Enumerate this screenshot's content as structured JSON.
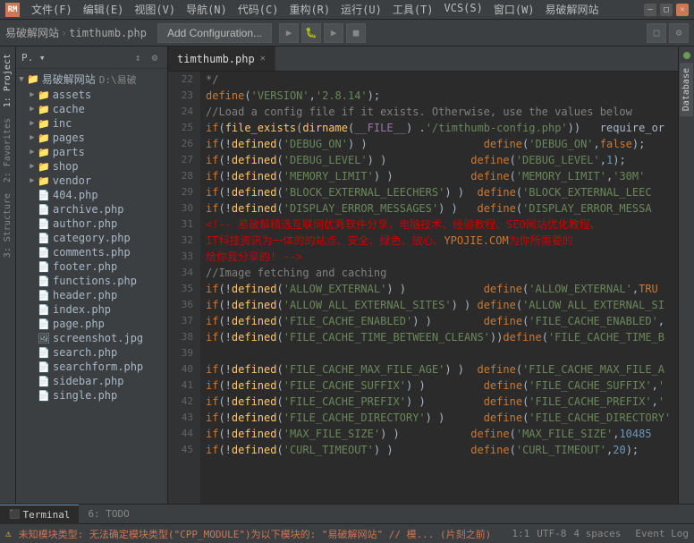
{
  "titlebar": {
    "app_icon": "RM",
    "menus": [
      "文件(F)",
      "编辑(E)",
      "视图(V)",
      "导航(N)",
      "代码(C)",
      "重构(R)",
      "运行(U)",
      "工具(T)",
      "VCS(S)",
      "窗口(W)",
      "易破解网站"
    ],
    "title": "易破解网站",
    "win_controls": [
      "—",
      "□",
      "✕"
    ]
  },
  "toolbar": {
    "breadcrumb": [
      "易破解网站",
      "timthumb.php"
    ],
    "config_btn": "Add Configuration...",
    "layout_icons": [
      "□"
    ]
  },
  "sidebar": {
    "header": "P. ▾",
    "icons": [
      "↕",
      "⚙"
    ],
    "root_label": "易破解网站",
    "root_path": "D:\\易破",
    "items": [
      {
        "type": "folder",
        "label": "assets",
        "indent": 1,
        "expanded": false
      },
      {
        "type": "folder",
        "label": "cache",
        "indent": 1,
        "expanded": false
      },
      {
        "type": "folder",
        "label": "inc",
        "indent": 1,
        "expanded": false
      },
      {
        "type": "folder",
        "label": "pages",
        "indent": 1,
        "expanded": false
      },
      {
        "type": "folder",
        "label": "parts",
        "indent": 1,
        "expanded": false
      },
      {
        "type": "folder",
        "label": "shop",
        "indent": 1,
        "expanded": false
      },
      {
        "type": "folder",
        "label": "vendor",
        "indent": 1,
        "expanded": false
      },
      {
        "type": "file",
        "label": "404.php",
        "indent": 1
      },
      {
        "type": "file",
        "label": "archive.php",
        "indent": 1
      },
      {
        "type": "file",
        "label": "author.php",
        "indent": 1
      },
      {
        "type": "file",
        "label": "category.php",
        "indent": 1
      },
      {
        "type": "file",
        "label": "comments.php",
        "indent": 1
      },
      {
        "type": "file",
        "label": "footer.php",
        "indent": 1
      },
      {
        "type": "file",
        "label": "functions.php",
        "indent": 1
      },
      {
        "type": "file",
        "label": "header.php",
        "indent": 1
      },
      {
        "type": "file",
        "label": "index.php",
        "indent": 1
      },
      {
        "type": "file",
        "label": "page.php",
        "indent": 1
      },
      {
        "type": "file",
        "label": "screenshot.jpg",
        "indent": 1
      },
      {
        "type": "file",
        "label": "search.php",
        "indent": 1
      },
      {
        "type": "file",
        "label": "searchform.php",
        "indent": 1
      },
      {
        "type": "file",
        "label": "sidebar.php",
        "indent": 1
      },
      {
        "type": "file",
        "label": "single.php",
        "indent": 1
      }
    ]
  },
  "editor": {
    "tab_label": "timthumb.php",
    "lines": [
      {
        "num": 22,
        "content": "*/"
      },
      {
        "num": 23,
        "content": "define ('VERSION', '2.8.14');"
      },
      {
        "num": 24,
        "content": "//Load a config file if it exists. Otherwise, use the values below"
      },
      {
        "num": 25,
        "content": "if( file_exists(dirname(__FILE__) . '/timthumb-config.php'))   require_or"
      },
      {
        "num": 26,
        "content": "if(! defined('DEBUG_ON') )                  define ('DEBUG_ON', false);"
      },
      {
        "num": 27,
        "content": "if(! defined('DEBUG_LEVEL') )               define ('DEBUG_LEVEL', 1);"
      },
      {
        "num": 28,
        "content": "if(! defined('MEMORY_LIMIT') )              define ('MEMORY_LIMIT', '30M'"
      },
      {
        "num": 29,
        "content": "if(! defined('BLOCK_EXTERNAL_LEECHERS') )   define ('BLOCK_EXTERNAL_LEEC"
      },
      {
        "num": 30,
        "content": "if(! defined('DISPLAY_ERROR_MESSAGES') )    define ('DISPLAY_ERROR_MESSA"
      },
      {
        "num": 31,
        "content": "<!-- 易破解精选互联网优秀软件分享，电脑技术、经验教程、SEO网站优化教程、"
      },
      {
        "num": 32,
        "content": "IT科技资讯为一体的的站点、安全、绿色、放心、YPOJIE.COM为你所需要的"
      },
      {
        "num": 33,
        "content": "给你我分享的! -->"
      },
      {
        "num": 34,
        "content": "//Image fetching and caching"
      },
      {
        "num": 35,
        "content": "if(! defined('ALLOW_EXTERNAL') )            define ('ALLOW_EXTERNAL', TRU"
      },
      {
        "num": 36,
        "content": "if(! defined('ALLOW_ALL_EXTERNAL_SITES') )  define ('ALLOW_ALL_EXTERNAL_SI"
      },
      {
        "num": 37,
        "content": "if(! defined('FILE_CACHE_ENABLED') )        define ('FILE_CACHE_ENABLED',"
      },
      {
        "num": 38,
        "content": "if(! defined('FILE_CACHE_TIME_BETWEEN_CLEANS')) define ('FILE_CACHE_TIME_B"
      },
      {
        "num": 39,
        "content": ""
      },
      {
        "num": 40,
        "content": "if(! defined('FILE_CACHE_MAX_FILE_AGE') )   define ('FILE_CACHE_MAX_FILE_A"
      },
      {
        "num": 41,
        "content": "if(! defined('FILE_CACHE_SUFFIX') )         define ('FILE_CACHE_SUFFIX', '"
      },
      {
        "num": 42,
        "content": "if(! defined('FILE_CACHE_PREFIX') )         define ('FILE_CACHE_PREFIX', '"
      },
      {
        "num": 43,
        "content": "if(! defined('FILE_CACHE_DIRECTORY') )      define ('FILE_CACHE_DIRECTORY'"
      },
      {
        "num": 44,
        "content": "if(! defined('MAX_FILE_SIZE') )             define ('MAX_FILE_SIZE', 10485"
      },
      {
        "num": 45,
        "content": "if(! defined('CURL_TIMEOUT') )              define ('CURL_TIMEOUT', 20);"
      }
    ]
  },
  "left_panel_tabs": [
    "1: Project",
    "2: Favorites",
    "3: Structure"
  ],
  "right_panel_tabs": [
    "Database"
  ],
  "bottom_tabs": [
    "Terminal",
    "6: TODO"
  ],
  "statusbar": {
    "warning_text": "未知模块类型: 无法确定模块类型(\"CPP_MODULE\")为以下模块的: \"易破解网站\" // 模... (片刻之前)",
    "position": "1:1",
    "encoding": "UTF-8",
    "indent": "4 spaces",
    "event_log": "Event Log"
  }
}
